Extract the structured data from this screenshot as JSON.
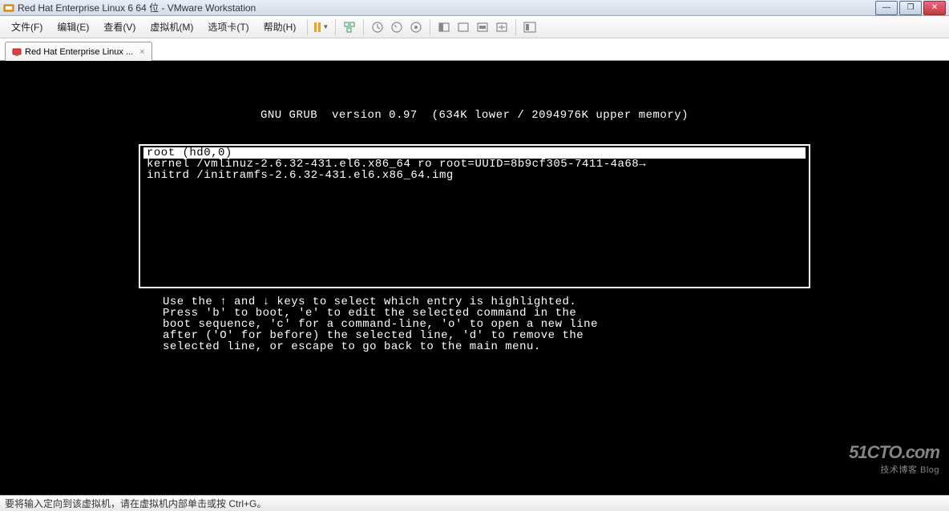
{
  "window": {
    "title": "Red Hat Enterprise Linux 6 64 位 - VMware Workstation"
  },
  "menu": {
    "file": "文件(F)",
    "edit": "编辑(E)",
    "view": "查看(V)",
    "vm": "虚拟机(M)",
    "tabs": "选项卡(T)",
    "help": "帮助(H)"
  },
  "tab": {
    "label": "Red Hat Enterprise Linux ...",
    "close": "×"
  },
  "grub": {
    "header": "GNU GRUB  version 0.97  (634K lower / 2094976K upper memory)",
    "entries": [
      "root (hd0,0)",
      "kernel /vmlinuz-2.6.32-431.el6.x86_64 ro root=UUID=8b9cf305-7411-4a68→",
      "initrd /initramfs-2.6.32-431.el6.x86_64.img"
    ],
    "help": "Use the ↑ and ↓ keys to select which entry is highlighted.\nPress 'b' to boot, 'e' to edit the selected command in the\nboot sequence, 'c' for a command-line, 'o' to open a new line\nafter ('O' for before) the selected line, 'd' to remove the\nselected line, or escape to go back to the main menu."
  },
  "statusbar": {
    "text": "要将输入定向到该虚拟机，请在虚拟机内部单击或按 Ctrl+G。"
  },
  "watermark": {
    "line1": "51CTO.com",
    "line2": "技术博客  Blog"
  }
}
